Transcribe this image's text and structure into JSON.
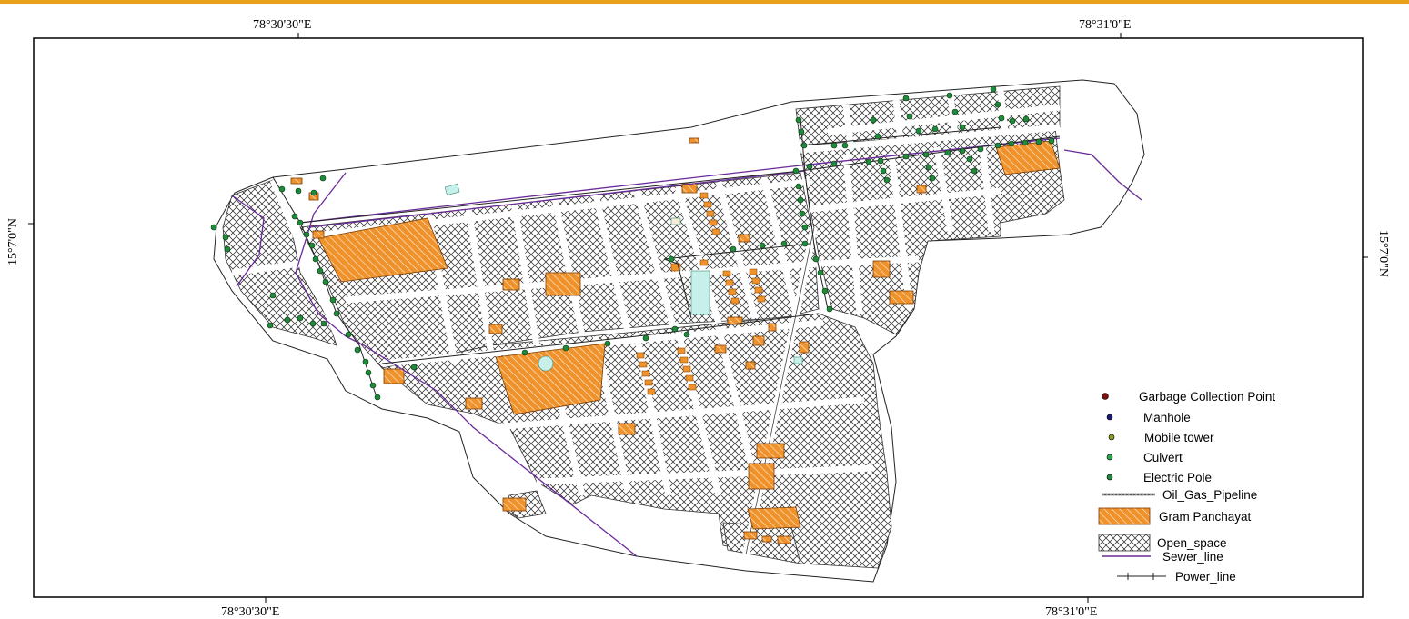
{
  "coordinates": {
    "top_left": "78°30'30\"E",
    "top_right": "78°31'0\"E",
    "bottom_left": "78°30'30\"E",
    "bottom_right": "78°31'0\"E",
    "left_lat": "15°7'0\"N",
    "right_lat": "15°7'0\"N"
  },
  "legend": {
    "garbage": "Garbage Collection Point",
    "manhole": "Manhole",
    "mobile_tower": "Mobile tower",
    "culvert": "Culvert",
    "electric_pole": "Electric Pole",
    "oil_gas": "Oil_Gas_Pipeline",
    "gram_panchayat": "Gram Panchayat",
    "open_space": "Open_space",
    "sewer": "Sewer_line",
    "power": "Power_line"
  },
  "colors": {
    "accent_bar": "#e8a21a",
    "gram_panchayat": "#f0922b",
    "electric_pole": "#1f8a3a",
    "sewer_line": "#6a2a9a",
    "garbage": "#7a1010",
    "manhole": "#1a1a7a"
  }
}
